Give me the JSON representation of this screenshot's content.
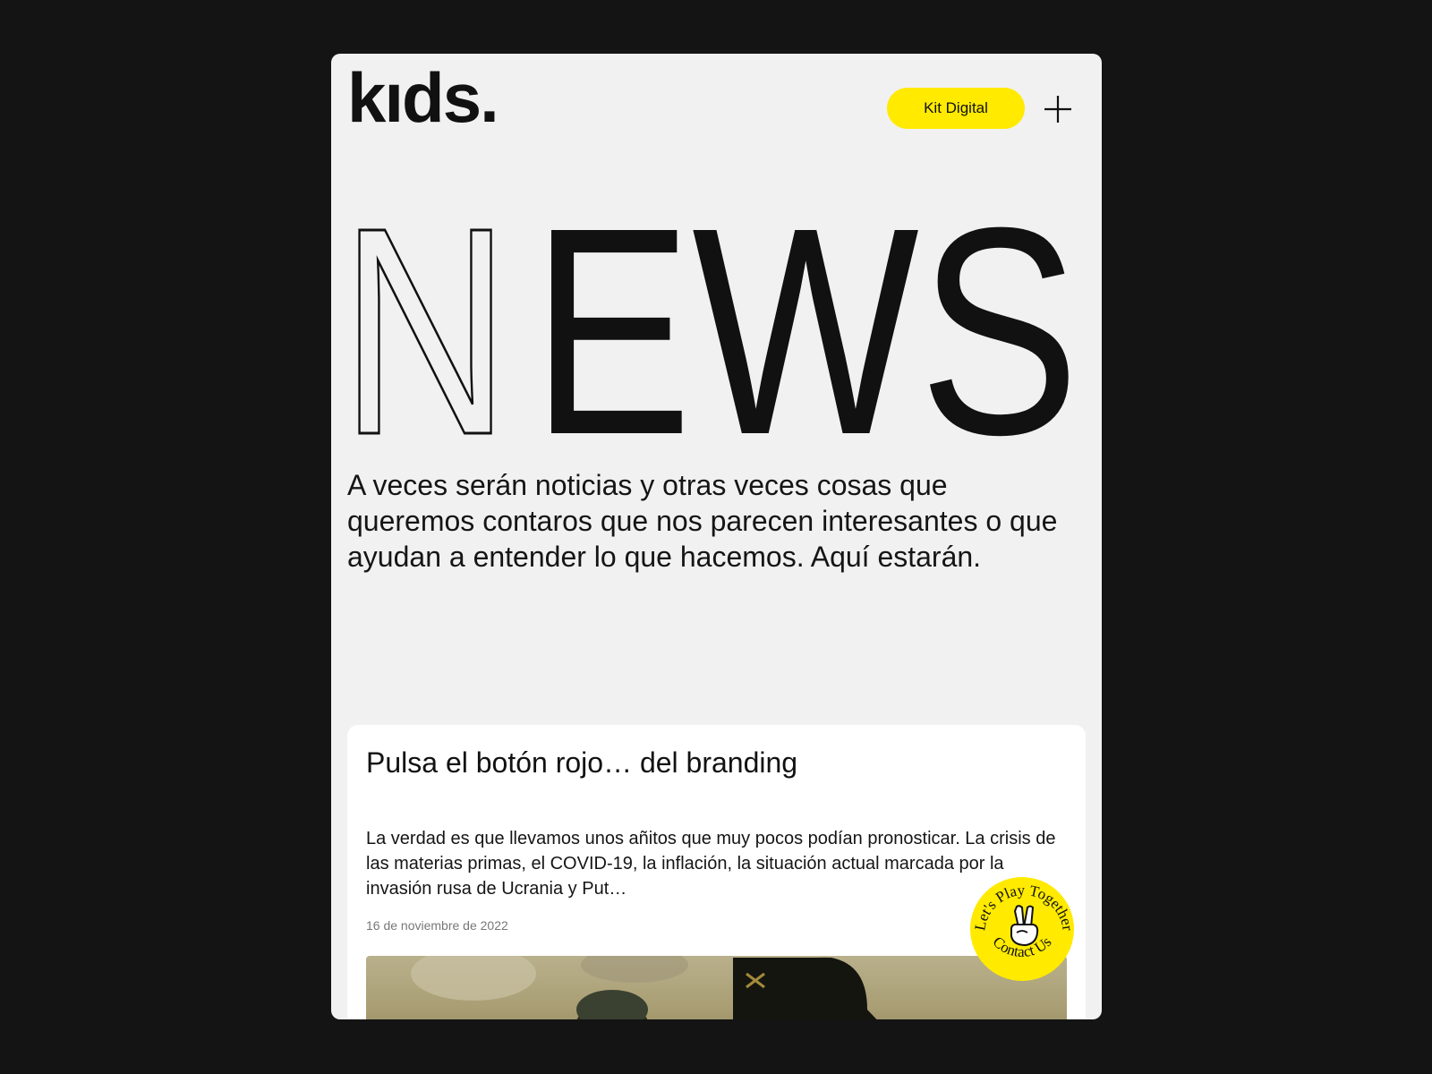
{
  "header": {
    "logo_text": "kıds.",
    "kit_button_label": "Kit Digital",
    "menu_icon": "plus-icon"
  },
  "hero": {
    "title": "NEWS",
    "outlined_letter": "N",
    "solid_letters": "EWS"
  },
  "intro": {
    "text": "A veces serán noticias y otras veces cosas que queremos contaros que nos parecen interesantes o que ayudan a entender lo que hacemos. Aquí estarán."
  },
  "article": {
    "title": "Pulsa el botón rojo… del branding",
    "excerpt": "La verdad es que llevamos unos añitos que muy pocos podían pronosticar. La crisis de las materias primas, el COVID-19, la inflación, la situación actual marcada por la invasión rusa de Ucrania y Put…",
    "date": "16 de noviembre de 2022"
  },
  "sticker": {
    "top_text": "Let's Play Together",
    "bottom_text": "Contact Us",
    "icon": "peace-hand-icon"
  },
  "colors": {
    "background": "#141414",
    "page": "#f1f1f1",
    "accent": "#ffea00",
    "text": "#111111"
  }
}
